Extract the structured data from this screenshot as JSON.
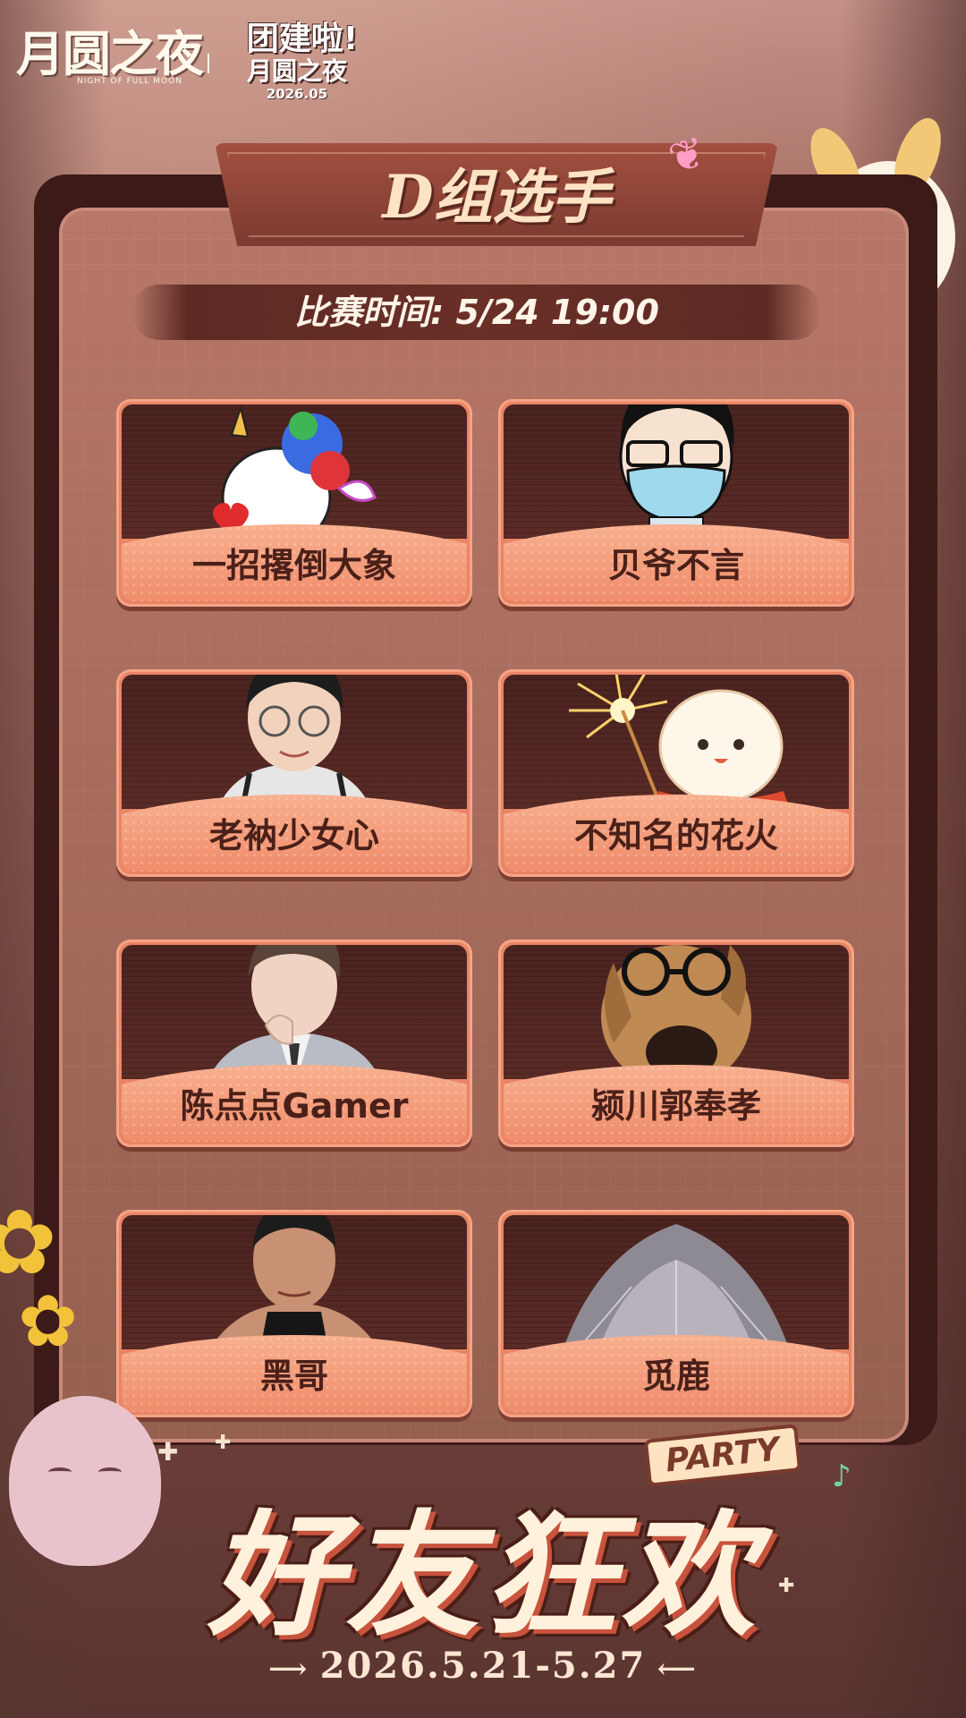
{
  "header": {
    "logo_cn": "月圆之夜",
    "logo_en": "NIGHT OF FULL MOON",
    "event_line1": "团建啦!",
    "event_line2": "月圆之夜",
    "event_date": "2026.05"
  },
  "panel": {
    "title": "D组选手",
    "match_time": "比赛时间: 5/24 19:00"
  },
  "players": [
    {
      "name": "一招撂倒大象",
      "avatar": "unicorn-doodle-avatar"
    },
    {
      "name": "贝爷不言",
      "avatar": "masked-boy-cartoon-avatar"
    },
    {
      "name": "老衲少女心",
      "avatar": "man-with-glasses-photo-avatar"
    },
    {
      "name": "不知名的花火",
      "avatar": "bun-with-sparkler-avatar"
    },
    {
      "name": "陈点点Gamer",
      "avatar": "man-in-suit-photo-avatar"
    },
    {
      "name": "颍川郭奉孝",
      "avatar": "dog-with-glasses-avatar"
    },
    {
      "name": "黑哥",
      "avatar": "man-in-tank-top-photo-avatar"
    },
    {
      "name": "觅鹿",
      "avatar": "anime-character-avatar"
    }
  ],
  "footer": {
    "party_tag": "PARTY",
    "title": "好友狂欢",
    "date_range": "2026.5.21-5.27"
  },
  "colors": {
    "panel_dark": "#3b1a18",
    "card_orange": "#e98566",
    "name_text": "#4a2019",
    "title_text": "#fde3c4"
  }
}
